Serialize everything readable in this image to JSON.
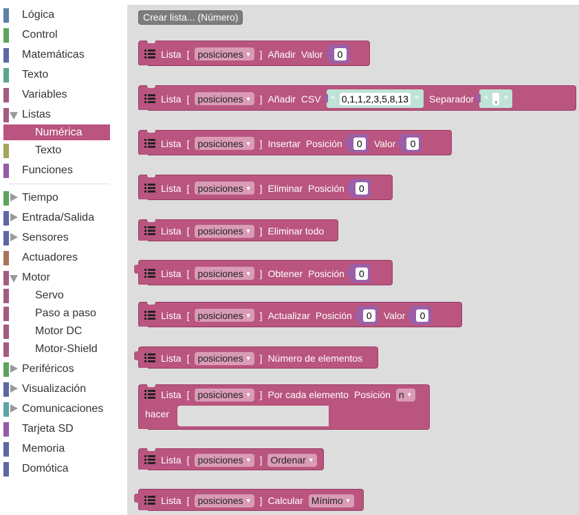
{
  "sidebar": {
    "items": [
      {
        "label": "Lógica",
        "color": "#5b80a5"
      },
      {
        "label": "Control",
        "color": "#5ba55b"
      },
      {
        "label": "Matemáticas",
        "color": "#5b67a5"
      },
      {
        "label": "Texto",
        "color": "#5ba58c"
      },
      {
        "label": "Variables",
        "color": "#a55b80"
      },
      {
        "label": "Listas",
        "color": "#a55b80"
      },
      {
        "label": "Numérica",
        "color": "#b9557f"
      },
      {
        "label": "Texto",
        "color": "#a5a55b"
      },
      {
        "label": "Funciones",
        "color": "#995ba5"
      },
      {
        "label": "Tiempo",
        "color": "#5ba55b"
      },
      {
        "label": "Entrada/Salida",
        "color": "#5b67a5"
      },
      {
        "label": "Sensores",
        "color": "#5b67a5"
      },
      {
        "label": "Actuadores",
        "color": "#a5745b"
      },
      {
        "label": "Motor",
        "color": "#a55b80"
      },
      {
        "label": "Servo",
        "color": "#a55b80"
      },
      {
        "label": "Paso a paso",
        "color": "#a55b80"
      },
      {
        "label": "Motor DC",
        "color": "#a55b80"
      },
      {
        "label": "Motor-Shield",
        "color": "#a55b80"
      },
      {
        "label": "Periféricos",
        "color": "#5ba55b"
      },
      {
        "label": "Visualización",
        "color": "#5b67a5"
      },
      {
        "label": "Comunicaciones",
        "color": "#5ba5a5"
      },
      {
        "label": "Tarjeta SD",
        "color": "#995ba5"
      },
      {
        "label": "Memoria",
        "color": "#5b67a5"
      },
      {
        "label": "Domótica",
        "color": "#5b67a5"
      }
    ]
  },
  "workspace": {
    "create_button": "Crear lista... (Número)",
    "list_word": "Lista",
    "bracket_open": "[",
    "bracket_close": "]",
    "var_name": "posiciones",
    "blocks": {
      "add": {
        "action": "Añadir",
        "field": "Valor",
        "value": "0"
      },
      "add_csv": {
        "action": "Añadir",
        "field": "CSV",
        "csv_value": "0,1,1,2,3,5,8,13",
        "sep_label": "Separador",
        "sep_value": ","
      },
      "insert": {
        "action": "Insertar",
        "field1": "Posición",
        "value1": "0",
        "field2": "Valor",
        "value2": "0"
      },
      "remove": {
        "action": "Eliminar",
        "field": "Posición",
        "value": "0"
      },
      "remove_all": {
        "action": "Eliminar todo"
      },
      "get": {
        "action": "Obtener",
        "field": "Posición",
        "value": "0"
      },
      "update": {
        "action": "Actualizar",
        "field1": "Posición",
        "value1": "0",
        "field2": "Valor",
        "value2": "0"
      },
      "count": {
        "action": "Número de elementos"
      },
      "foreach": {
        "action": "Por cada elemento",
        "field": "Posición",
        "var": "n",
        "do_label": "hacer"
      },
      "sort": {
        "action": "Ordenar"
      },
      "calc": {
        "action": "Calcular",
        "option": "Mínimo"
      }
    }
  },
  "colors": {
    "list_block": "#b9557f",
    "selected_category": "#b9557f",
    "workspace_bg": "#dddddd",
    "number_slot": "#9a5fa8",
    "string_slot": "#bfe3d6"
  },
  "icons": {
    "list_icon": "list-icon",
    "dropdown_arrow": "▼",
    "open_quote": "“",
    "close_quote": "”"
  }
}
